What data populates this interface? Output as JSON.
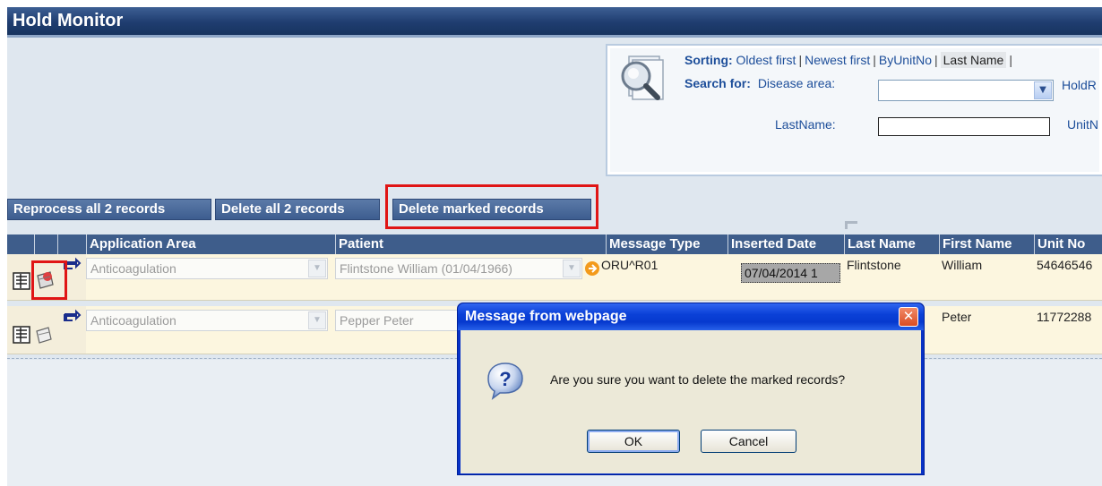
{
  "page": {
    "title": "Hold Monitor"
  },
  "search": {
    "sorting_label": "Sorting:",
    "sort_options": [
      "Oldest first",
      "Newest first",
      "ByUnitNo",
      "Last Name",
      "|"
    ],
    "active_sort": "Last Name",
    "search_label": "Search for:",
    "disease_area_label": "Disease area:",
    "disease_area_value": "",
    "holdr_label": "HoldR",
    "lastname_label": "LastName:",
    "lastname_value": "",
    "unitn_label": "UnitN"
  },
  "actions": {
    "reprocess_label": "Reprocess all 2 records",
    "delete_all_label": "Delete all 2 records",
    "delete_marked_label": "Delete marked records"
  },
  "grid": {
    "columns": [
      "Application Area",
      "Patient",
      "Message Type",
      "Inserted Date",
      "Last Name",
      "First Name",
      "Unit No"
    ],
    "rows": [
      {
        "application_area": "Anticoagulation",
        "patient": "Flintstone William (01/04/1966)",
        "message_type": "ORU^R01",
        "inserted_date": "07/04/2014 1",
        "last_name": "Flintstone",
        "first_name": "William",
        "unit_no": "54646546"
      },
      {
        "application_area": "Anticoagulation",
        "patient": "Pepper Peter",
        "message_type": "",
        "inserted_date": "",
        "last_name": "",
        "first_name": "Peter",
        "unit_no": "11772288"
      }
    ]
  },
  "dialog": {
    "title": "Message from webpage",
    "message": "Are you sure you want to delete the marked records?",
    "ok_label": "OK",
    "cancel_label": "Cancel",
    "close_glyph": "✕"
  },
  "colors": {
    "title_bar": "#1f3d70",
    "highlight_red": "#e01515",
    "dialog_blue": "#0b41d8"
  },
  "icons": [
    "search-magnifier-icon",
    "details-icon",
    "delete-marker-icon",
    "reprocess-arrows-icon",
    "chevron-down-icon",
    "question-icon",
    "close-icon",
    "orange-arrow-icon"
  ]
}
